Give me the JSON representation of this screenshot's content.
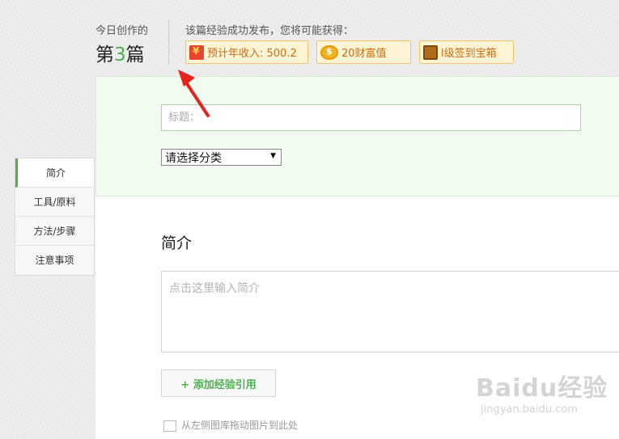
{
  "header": {
    "today_label": "今日创作的",
    "count_prefix": "第",
    "count_number": "3",
    "count_suffix": "篇",
    "reward_title": "该篇经验成功发布，您将可能获得：",
    "rewards": [
      {
        "icon": "red-envelope-icon",
        "label": "预计年收入: 500.2"
      },
      {
        "icon": "coin-icon",
        "label": "20财富值"
      },
      {
        "icon": "treasure-chest-icon",
        "label": "l级签到宝箱"
      }
    ]
  },
  "form": {
    "title_placeholder": "标题：",
    "category_selected": "请选择分类",
    "section_heading": "简介",
    "intro_placeholder": "点击这里输入简介",
    "add_reference_label": "+ 添加经验引用",
    "drag_hint": "从左侧图库拖动图片到此处"
  },
  "sidebar": {
    "items": [
      {
        "label": "简介",
        "active": true
      },
      {
        "label": "工具/原料",
        "active": false
      },
      {
        "label": "方法/步骤",
        "active": false
      },
      {
        "label": "注意事项",
        "active": false
      }
    ]
  },
  "watermark": {
    "top": "Baidu经验",
    "bottom": "jingyan.baidu.com"
  },
  "colors": {
    "accent": "#4caf50",
    "reward_text": "#d06b0c",
    "annotation": "#e8231d"
  }
}
